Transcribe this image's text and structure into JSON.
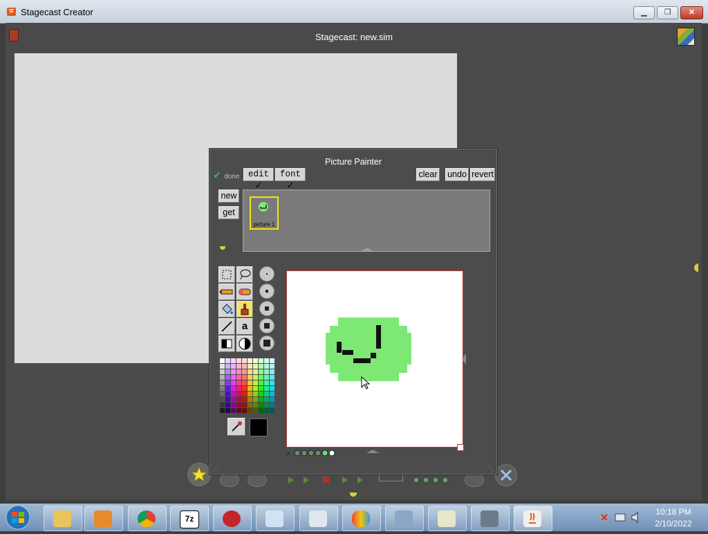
{
  "window": {
    "title": "Stagecast Creator",
    "stage_title": "Stagecast: new.sim"
  },
  "painter": {
    "title": "Picture Painter",
    "done_label": "done",
    "edit_menu": "edit",
    "font_menu": "font",
    "clear_label": "clear",
    "undo_label": "undo",
    "revert_label": "revert",
    "new_label": "new",
    "get_label": "get",
    "picture_name": "picture 1",
    "current_color": "#000000",
    "tools": [
      "rectangle-select",
      "lasso",
      "pencil",
      "eraser",
      "paint-bucket",
      "paint-brush",
      "line",
      "text",
      "fill-rect",
      "contrast"
    ],
    "text_tool_glyph": "a"
  },
  "taskbar": {
    "time": "10:18 PM",
    "date": "2/10/2022",
    "items": [
      "windows-explorer",
      "media-player",
      "chrome",
      "7zip",
      "adobe-reader",
      "notepad",
      "calculator",
      "rubik-app",
      "network-app",
      "paint-app",
      "task-view",
      "java"
    ]
  },
  "colors": {
    "sprite_green": "#7ee875",
    "title_bar": "#dfe6ee",
    "selection_yellow": "#f2e800"
  }
}
